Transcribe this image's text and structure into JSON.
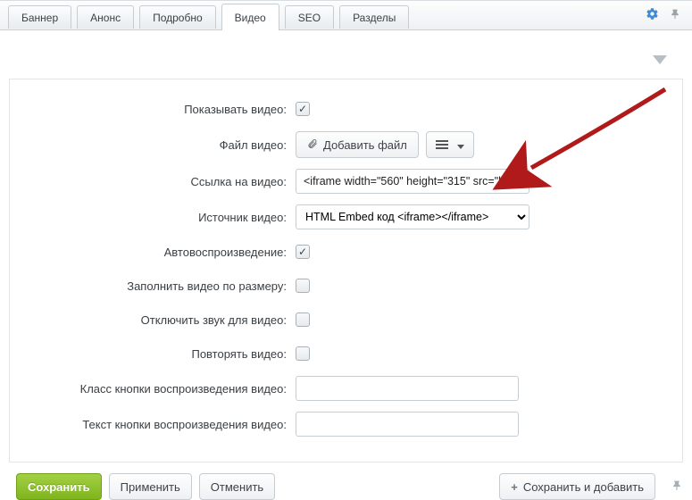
{
  "tabs": {
    "banner": "Баннер",
    "anons": "Анонс",
    "detail": "Подробно",
    "video": "Видео",
    "seo": "SEO",
    "sections": "Разделы"
  },
  "form": {
    "show_video_label": "Показывать видео:",
    "file_video_label": "Файл видео:",
    "add_file_btn": "Добавить файл",
    "video_link_label": "Ссылка на видео:",
    "video_link_value": "<iframe width=\"560\" height=\"315\" src=\"ht",
    "video_source_label": "Источник видео:",
    "video_source_selected": "HTML Embed код <iframe></iframe>",
    "autoplay_label": "Автовоспроизведение:",
    "fill_size_label": "Заполнить видео по размеру:",
    "mute_label": "Отключить звук для видео:",
    "loop_label": "Повторять видео:",
    "play_btn_class_label": "Класс кнопки воспроизведения видео:",
    "play_btn_class_value": "",
    "play_btn_text_label": "Текст кнопки воспроизведения видео:",
    "play_btn_text_value": ""
  },
  "footer": {
    "save": "Сохранить",
    "apply": "Применить",
    "cancel": "Отменить",
    "save_add": "Сохранить и добавить"
  }
}
